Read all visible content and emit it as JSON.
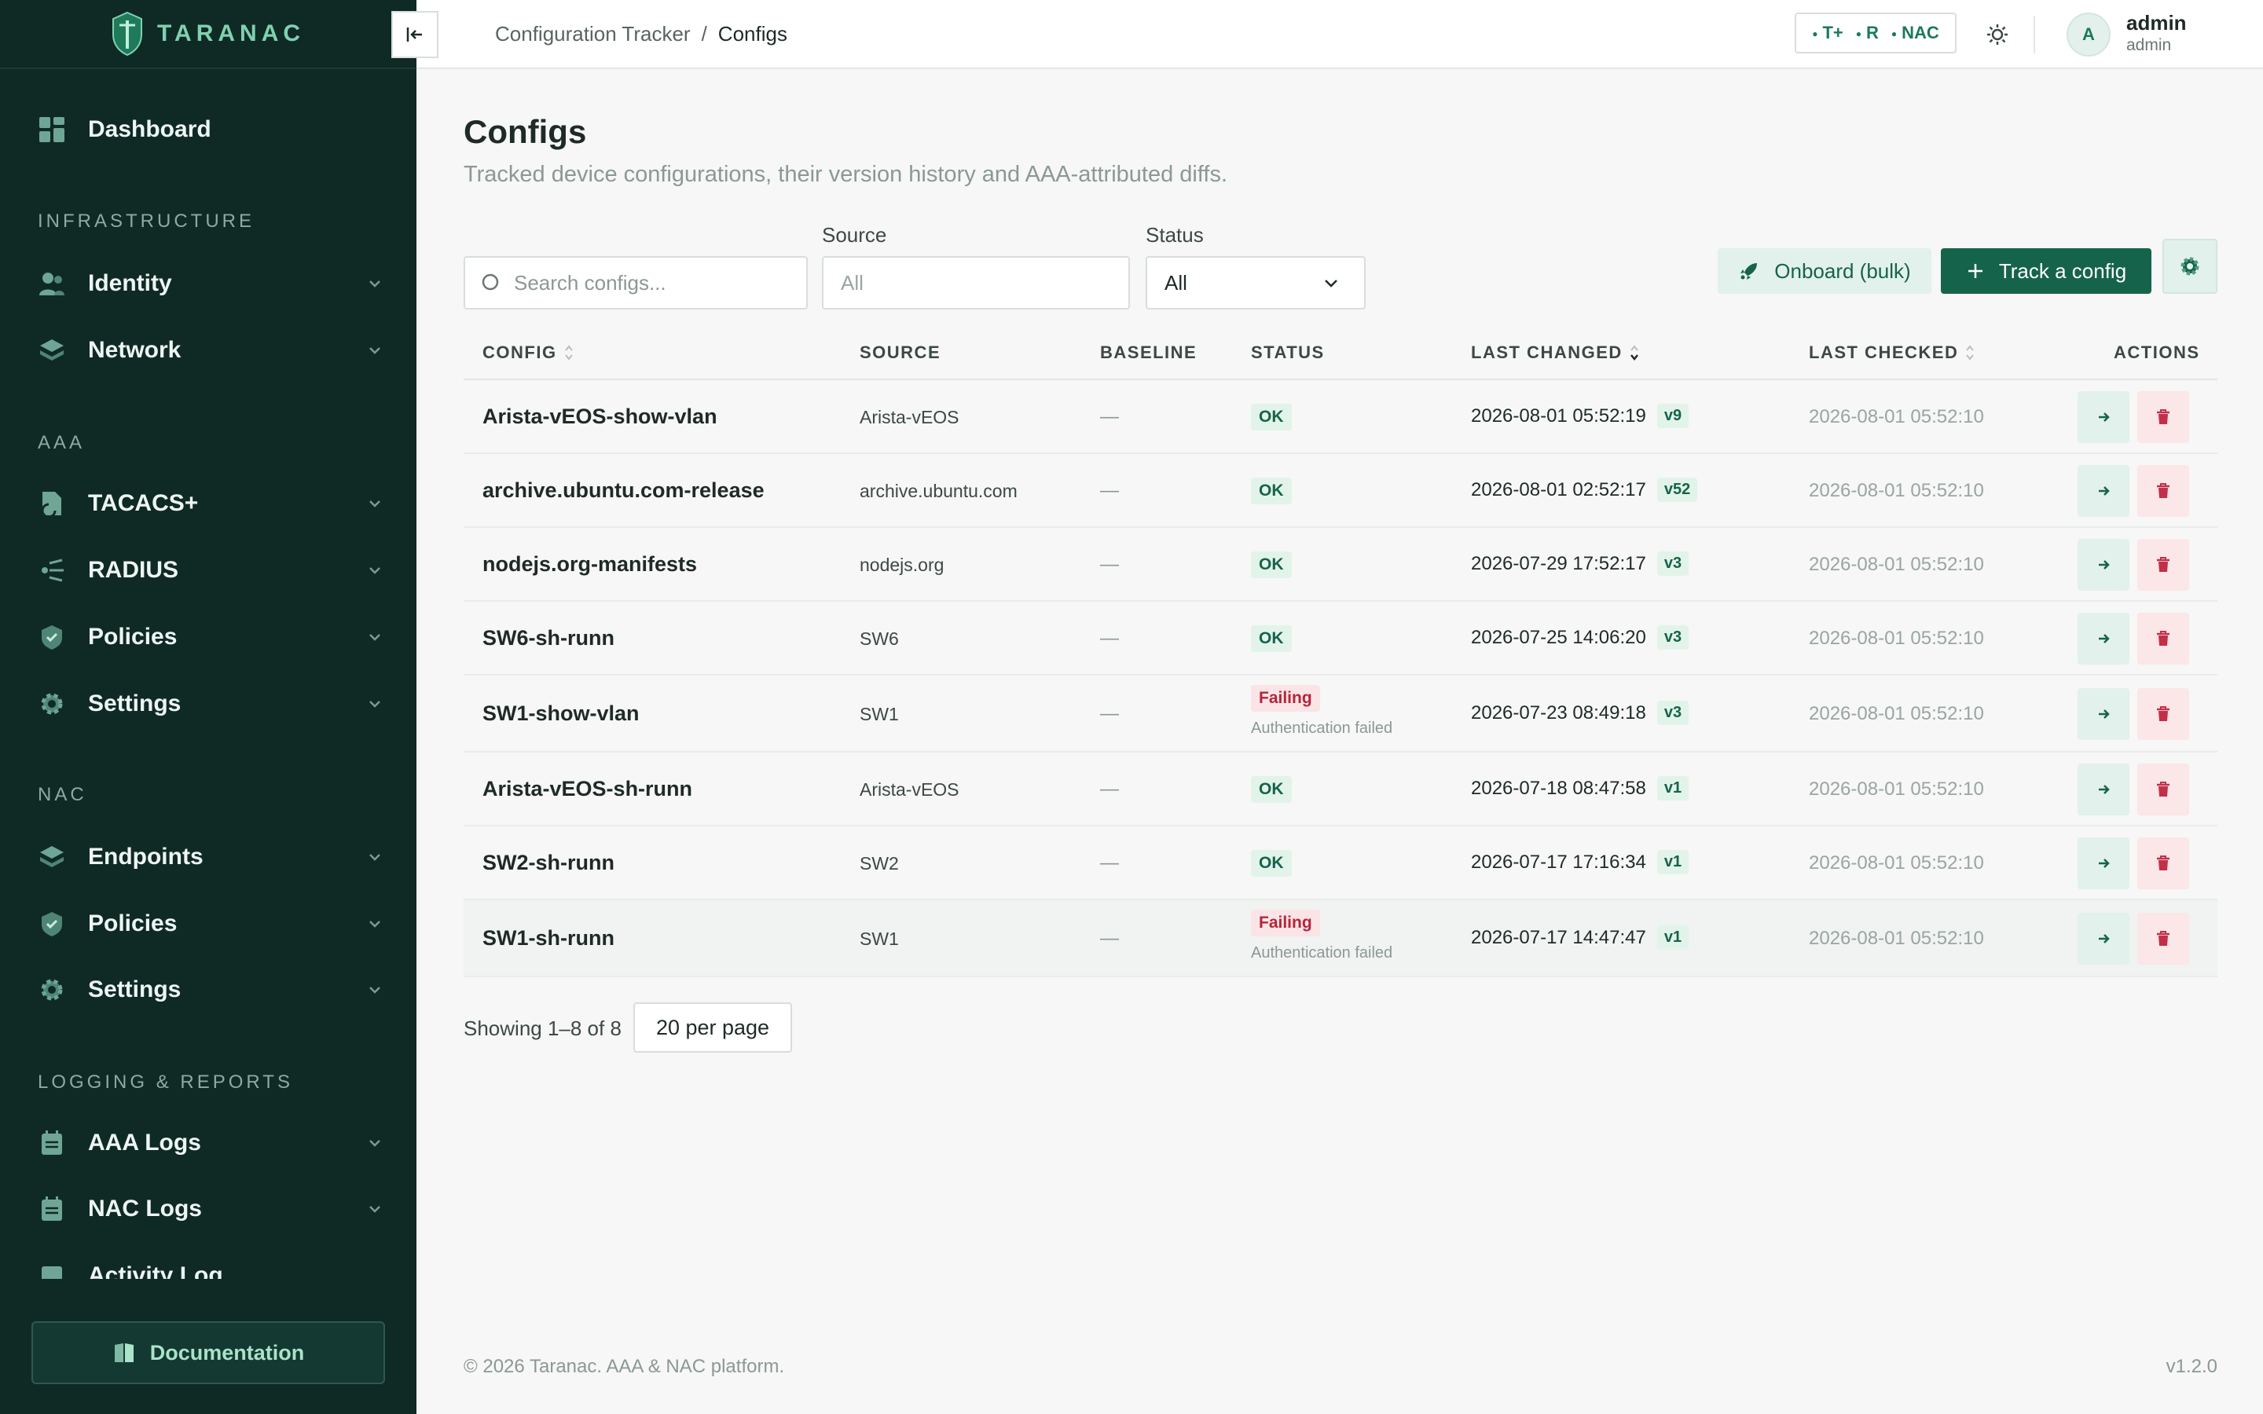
{
  "brand": {
    "name": "TARANAC"
  },
  "sidebar": {
    "dashboard": {
      "label": "Dashboard",
      "icon": "grid-icon"
    },
    "sections": [
      {
        "title": "INFRASTRUCTURE",
        "items": [
          {
            "label": "Identity",
            "icon": "users-icon"
          },
          {
            "label": "Network",
            "icon": "layers-icon"
          }
        ]
      },
      {
        "title": "AAA",
        "items": [
          {
            "label": "TACACS+",
            "icon": "document-chart-icon"
          },
          {
            "label": "RADIUS",
            "icon": "signal-icon"
          },
          {
            "label": "Policies",
            "icon": "shield-check-icon"
          },
          {
            "label": "Settings",
            "icon": "gear-icon"
          }
        ]
      },
      {
        "title": "NAC",
        "items": [
          {
            "label": "Endpoints",
            "icon": "layers-icon"
          },
          {
            "label": "Policies",
            "icon": "shield-check-icon"
          },
          {
            "label": "Settings",
            "icon": "gear-icon"
          }
        ]
      },
      {
        "title": "LOGGING & REPORTS",
        "items": [
          {
            "label": "AAA Logs",
            "icon": "calendar-log-icon"
          },
          {
            "label": "NAC Logs",
            "icon": "calendar-log-icon"
          },
          {
            "label": "Activity Log",
            "icon": "activity-icon"
          }
        ]
      }
    ],
    "documentation": "Documentation"
  },
  "topbar": {
    "breadcrumb": {
      "parent": "Configuration Tracker",
      "sep": "/",
      "current": "Configs"
    },
    "protocols": [
      "T+",
      "R",
      "NAC"
    ],
    "user": {
      "initial": "A",
      "name": "admin",
      "role": "admin"
    }
  },
  "main": {
    "title": "Configs",
    "subtitle": "Tracked device configurations, their version history and AAA-attributed diffs.",
    "filters": {
      "search_placeholder": "Search configs...",
      "source_label": "Source",
      "source_placeholder": "All",
      "status_label": "Status",
      "status_value": "All"
    },
    "buttons": {
      "onboard": "Onboard (bulk)",
      "track": "Track a config"
    },
    "table": {
      "columns": [
        "CONFIG",
        "SOURCE",
        "BASELINE",
        "STATUS",
        "LAST CHANGED",
        "LAST CHECKED",
        "ACTIONS"
      ],
      "rows": [
        {
          "name": "Arista-vEOS-show-vlan",
          "source": "Arista-vEOS",
          "baseline": "—",
          "status": "OK",
          "error": "",
          "changed": "2026-08-01 05:52:19",
          "version": "v9",
          "checked": "2026-08-01 05:52:10"
        },
        {
          "name": "archive.ubuntu.com-release",
          "source": "archive.ubuntu.com",
          "baseline": "—",
          "status": "OK",
          "error": "",
          "changed": "2026-08-01 02:52:17",
          "version": "v52",
          "checked": "2026-08-01 05:52:10"
        },
        {
          "name": "nodejs.org-manifests",
          "source": "nodejs.org",
          "baseline": "—",
          "status": "OK",
          "error": "",
          "changed": "2026-07-29 17:52:17",
          "version": "v3",
          "checked": "2026-08-01 05:52:10"
        },
        {
          "name": "SW6-sh-runn",
          "source": "SW6",
          "baseline": "—",
          "status": "OK",
          "error": "",
          "changed": "2026-07-25 14:06:20",
          "version": "v3",
          "checked": "2026-08-01 05:52:10"
        },
        {
          "name": "SW1-show-vlan",
          "source": "SW1",
          "baseline": "—",
          "status": "Failing",
          "error": "Authentication failed",
          "changed": "2026-07-23 08:49:18",
          "version": "v3",
          "checked": "2026-08-01 05:52:10"
        },
        {
          "name": "Arista-vEOS-sh-runn",
          "source": "Arista-vEOS",
          "baseline": "—",
          "status": "OK",
          "error": "",
          "changed": "2026-07-18 08:47:58",
          "version": "v1",
          "checked": "2026-08-01 05:52:10"
        },
        {
          "name": "SW2-sh-runn",
          "source": "SW2",
          "baseline": "—",
          "status": "OK",
          "error": "",
          "changed": "2026-07-17 17:16:34",
          "version": "v1",
          "checked": "2026-08-01 05:52:10"
        },
        {
          "name": "SW1-sh-runn",
          "source": "SW1",
          "baseline": "—",
          "status": "Failing",
          "error": "Authentication failed",
          "changed": "2026-07-17 14:47:47",
          "version": "v1",
          "checked": "2026-08-01 05:52:10"
        }
      ]
    },
    "pager": {
      "showing": "Showing 1–8 of 8",
      "per_page": "20 per page"
    }
  },
  "footer": {
    "copyright": "© 2026 Taranac. AAA & NAC platform.",
    "version": "v1.2.0"
  },
  "colors": {
    "sidebar_bg": "#0f2a25",
    "accent": "#16634b",
    "ok_bg": "#e2f4ea",
    "fail_bg": "#fbe4e6",
    "fail_text": "#b3263a"
  }
}
